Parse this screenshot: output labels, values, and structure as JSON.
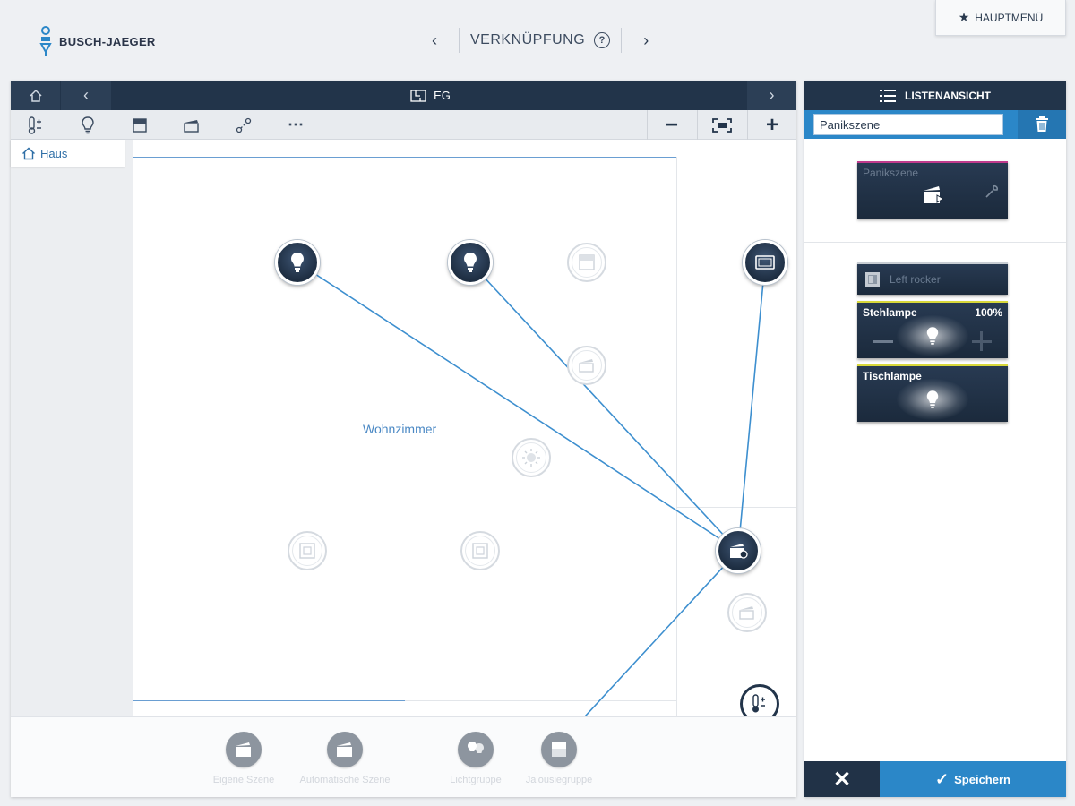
{
  "header": {
    "brand": "BUSCH-JAEGER",
    "title": "VERKNÜPFUNG",
    "help_icon": "help-icon",
    "main_menu_label": "HAUPTMENÜ"
  },
  "floor_nav": {
    "floor_label": "EG"
  },
  "toolbar": {
    "tools": [
      "thermostat-icon",
      "bulb-icon",
      "blind-icon",
      "scene-icon",
      "link-icon",
      "more-icon"
    ],
    "zoom_out_label": "−",
    "zoom_in_label": "+"
  },
  "tree": {
    "item_label": "Haus"
  },
  "canvas": {
    "room_label": "Wohnzimmer"
  },
  "bottom_bar": {
    "items": [
      {
        "label": "Eigene Szene",
        "icon": "scene-icon"
      },
      {
        "label": "Automatische Szene",
        "icon": "auto-scene-icon"
      },
      {
        "label": "Lichtgruppe",
        "icon": "light-group-icon"
      },
      {
        "label": "Jalousiegruppe",
        "icon": "blind-group-icon"
      }
    ]
  },
  "right_panel": {
    "title": "LISTENANSICHT",
    "name_value": "Panikszene",
    "scene_card_label": "Panikszene",
    "rocker_label": "Left rocker",
    "lamp1_label": "Stehlampe",
    "lamp1_value": "100%",
    "lamp2_label": "Tischlampe",
    "cancel_label": "✕",
    "save_label": "Speichern"
  },
  "colors": {
    "navy": "#22344a",
    "accent_blue": "#2b87c8",
    "link_line": "#3d8fcf",
    "scene_accent": "#c03a8c",
    "lamp_accent": "#d8d83a"
  }
}
